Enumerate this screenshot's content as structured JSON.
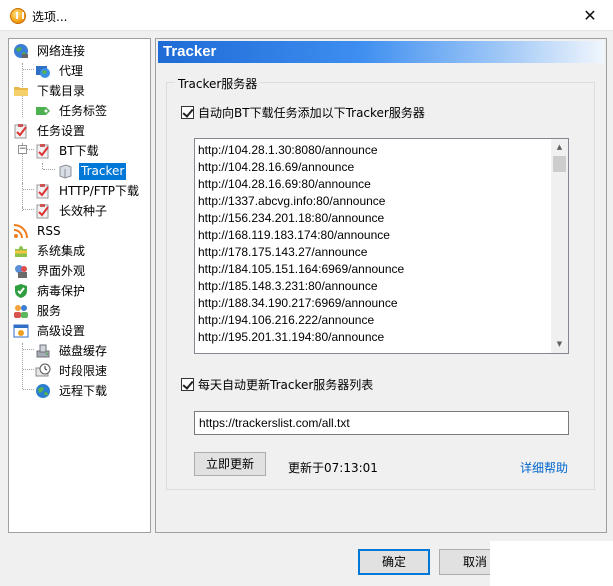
{
  "window": {
    "title": "选项...",
    "close_glyph": "✕"
  },
  "tree": {
    "items": [
      {
        "label": "网络连接",
        "icon": "globe-network-icon"
      },
      {
        "label": "代理",
        "icon": "proxy-globe-icon"
      },
      {
        "label": "下载目录",
        "icon": "folder-icon"
      },
      {
        "label": "任务标签",
        "icon": "tag-icon"
      },
      {
        "label": "任务设置",
        "icon": "clipboard-check-icon"
      },
      {
        "label": "BT下载",
        "icon": "clipboard-check-icon"
      },
      {
        "label": "Tracker",
        "icon": "server-icon",
        "selected": true
      },
      {
        "label": "HTTP/FTP下载",
        "icon": "clipboard-check-icon"
      },
      {
        "label": "长效种子",
        "icon": "clipboard-check-icon"
      },
      {
        "label": "RSS",
        "icon": "rss-icon"
      },
      {
        "label": "系统集成",
        "icon": "puzzle-icon"
      },
      {
        "label": "界面外观",
        "icon": "appearance-icon"
      },
      {
        "label": "病毒保护",
        "icon": "shield-icon"
      },
      {
        "label": "服务",
        "icon": "users-icon"
      },
      {
        "label": "高级设置",
        "icon": "advanced-settings-icon"
      },
      {
        "label": "磁盘缓存",
        "icon": "disk-cache-icon"
      },
      {
        "label": "时段限速",
        "icon": "speed-limit-icon"
      },
      {
        "label": "远程下载",
        "icon": "remote-globe-icon"
      }
    ]
  },
  "panel": {
    "title": "Tracker",
    "group_label": "Tracker服务器",
    "auto_add_label": "自动向BT下载任务添加以下Tracker服务器",
    "trackers": [
      "http://104.28.1.30:8080/announce",
      "http://104.28.16.69/announce",
      "http://104.28.16.69:80/announce",
      "http://1337.abcvg.info:80/announce",
      "http://156.234.201.18:80/announce",
      "http://168.119.183.174:80/announce",
      "http://178.175.143.27/announce",
      "http://184.105.151.164:6969/announce",
      "http://185.148.3.231:80/announce",
      "http://188.34.190.217:6969/announce",
      "http://194.106.216.222/announce",
      "http://195.201.31.194:80/announce"
    ],
    "auto_update_label": "每天自动更新Tracker服务器列表",
    "update_url": "https://trackerslist.com/all.txt",
    "update_now_button": "立即更新",
    "updated_at_text": "更新于07:13:01",
    "help_link": "详细帮助"
  },
  "footer": {
    "ok_button": "确定",
    "cancel_button": "取消"
  },
  "colors": {
    "selection": "#0078d7",
    "header_gradient_start": "#1e6bd6",
    "link": "#0066cc"
  }
}
